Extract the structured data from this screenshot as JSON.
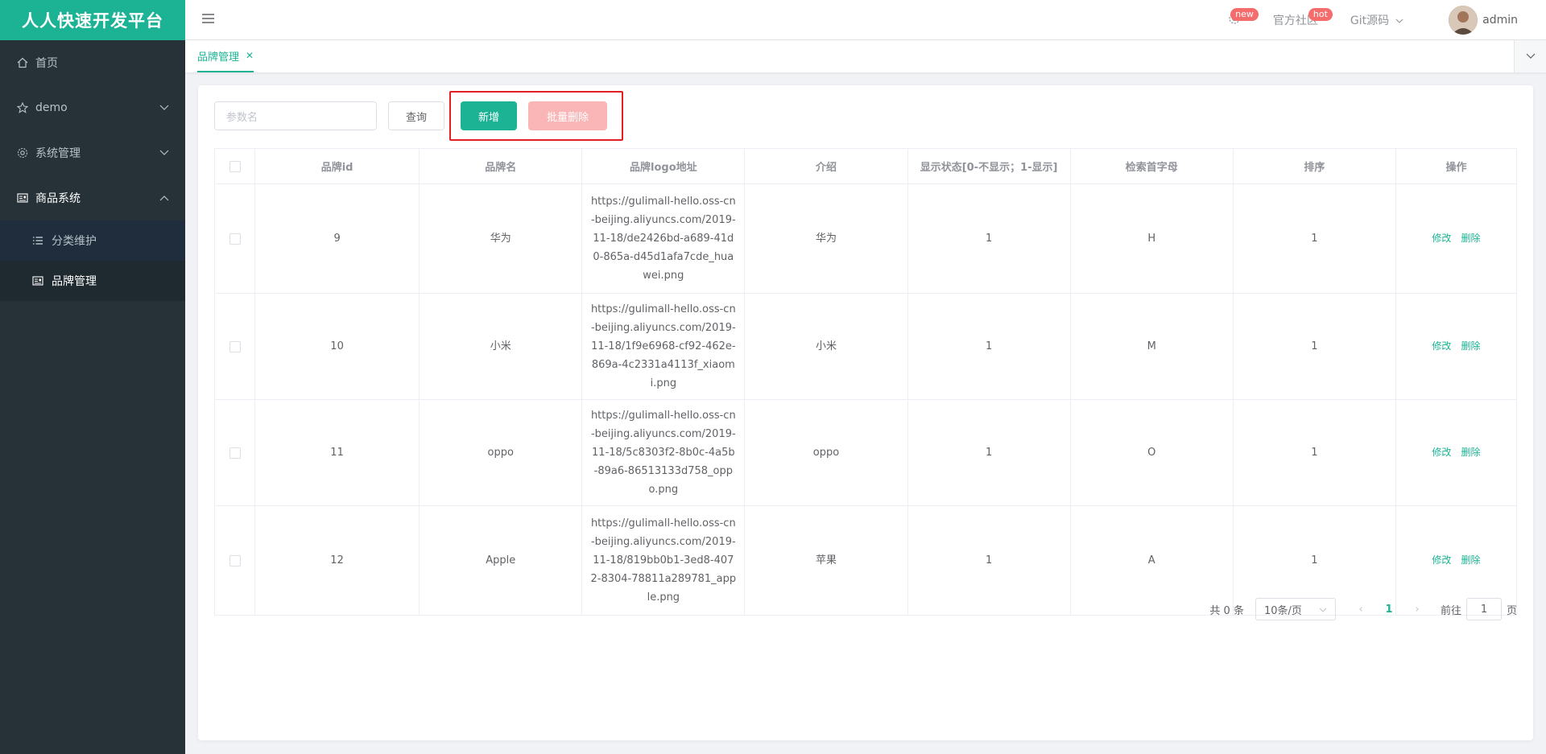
{
  "app": {
    "brand": "人人快速开发平台"
  },
  "sidebar": {
    "items": [
      {
        "label": "首页",
        "icon": "home-icon"
      },
      {
        "label": "demo",
        "icon": "star-icon"
      },
      {
        "label": "系统管理",
        "icon": "gear-icon"
      },
      {
        "label": "商品系统",
        "icon": "product-icon"
      }
    ],
    "submenu": [
      {
        "label": "分类维护",
        "icon": "list-icon"
      },
      {
        "label": "品牌管理",
        "icon": "brand-icon"
      }
    ]
  },
  "header": {
    "badge_new": "new",
    "community": "官方社区",
    "badge_hot": "hot",
    "git": "Git源码",
    "user": "admin"
  },
  "tabs": [
    {
      "label": "品牌管理"
    }
  ],
  "toolbar": {
    "search_placeholder": "参数名",
    "query": "查询",
    "add": "新增",
    "batch_delete": "批量删除"
  },
  "table": {
    "headers": [
      "品牌id",
      "品牌名",
      "品牌logo地址",
      "介绍",
      "显示状态[0-不显示；1-显示]",
      "检索首字母",
      "排序",
      "操作"
    ],
    "rows": [
      {
        "id": "9",
        "name": "华为",
        "logo": "https://gulimall-hello.oss-cn-beijing.aliyuncs.com/2019-11-18/de2426bd-a689-41d0-865a-d45d1afa7cde_huawei.png",
        "desc": "华为",
        "show": "1",
        "letter": "H",
        "sort": "1"
      },
      {
        "id": "10",
        "name": "小米",
        "logo": "https://gulimall-hello.oss-cn-beijing.aliyuncs.com/2019-11-18/1f9e6968-cf92-462e-869a-4c2331a4113f_xiaomi.png",
        "desc": "小米",
        "show": "1",
        "letter": "M",
        "sort": "1"
      },
      {
        "id": "11",
        "name": "oppo",
        "logo": "https://gulimall-hello.oss-cn-beijing.aliyuncs.com/2019-11-18/5c8303f2-8b0c-4a5b-89a6-86513133d758_oppo.png",
        "desc": "oppo",
        "show": "1",
        "letter": "O",
        "sort": "1"
      },
      {
        "id": "12",
        "name": "Apple",
        "logo": "https://gulimall-hello.oss-cn-beijing.aliyuncs.com/2019-11-18/819bb0b1-3ed8-4072-8304-78811a289781_apple.png",
        "desc": "苹果",
        "show": "1",
        "letter": "A",
        "sort": "1"
      }
    ],
    "edit": "修改",
    "delete": "删除"
  },
  "pagination": {
    "total": "共 0 条",
    "page_size": "10条/页",
    "current": "1",
    "goto_prefix": "前往",
    "goto_value": "1",
    "goto_suffix": "页"
  },
  "colors": {
    "accent": "#1bb394",
    "sidebar": "#263238",
    "danger_disabled": "#fab6b6",
    "highlight": "#e41f1f"
  }
}
